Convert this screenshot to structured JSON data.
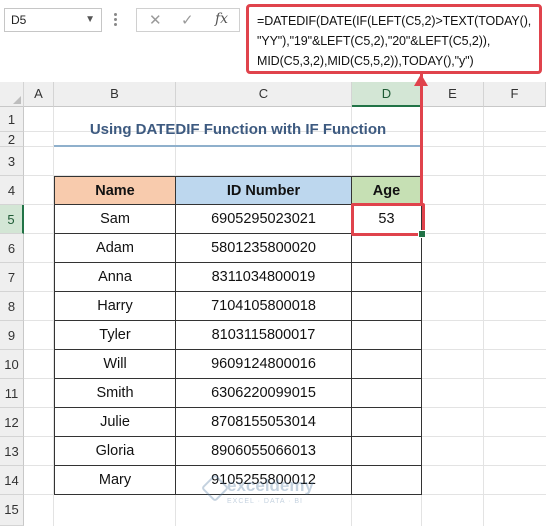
{
  "formula_bar": {
    "name_box": "D5",
    "cancel_icon": "close-icon",
    "enter_icon": "check-icon",
    "fx_label": "fx",
    "formula_line1": "=DATEDIF(DATE(IF(LEFT(C5,2)>TEXT(TODAY(),",
    "formula_line2": "\"YY\"),\"19\"&LEFT(C5,2),\"20\"&LEFT(C5,2)),",
    "formula_line3": "MID(C5,3,2),MID(C5,5,2)),TODAY(),\"y\")"
  },
  "columns": [
    "A",
    "B",
    "C",
    "D",
    "E",
    "F"
  ],
  "selected_column": "D",
  "rows": [
    "1",
    "2",
    "3",
    "4",
    "5",
    "6",
    "7",
    "8",
    "9",
    "10",
    "11",
    "12",
    "13",
    "14",
    "15"
  ],
  "selected_row": "5",
  "sheet": {
    "title": "Using DATEDIF Function with IF Function",
    "headers": {
      "name": "Name",
      "id": "ID Number",
      "age": "Age"
    },
    "records": [
      {
        "name": "Sam",
        "id": "6905295023021",
        "age": "53"
      },
      {
        "name": "Adam",
        "id": "5801235800020",
        "age": ""
      },
      {
        "name": "Anna",
        "id": "8311034800019",
        "age": ""
      },
      {
        "name": "Harry",
        "id": "7104105800018",
        "age": ""
      },
      {
        "name": "Tyler",
        "id": "8103115800017",
        "age": ""
      },
      {
        "name": "Will",
        "id": "9609124800016",
        "age": ""
      },
      {
        "name": "Smith",
        "id": "6306220099015",
        "age": ""
      },
      {
        "name": "Julie",
        "id": "8708155053014",
        "age": ""
      },
      {
        "name": "Gloria",
        "id": "8906055066013",
        "age": ""
      },
      {
        "name": "Mary",
        "id": "9105255800012",
        "age": ""
      }
    ]
  },
  "watermark": {
    "name": "exceldemy",
    "tagline": "EXCEL · DATA · BI"
  },
  "colors": {
    "highlight": "#e0434c",
    "name_header": "#f8cbad",
    "id_header": "#bdd7ee",
    "age_header": "#c6e0b4",
    "title": "#3d5a80"
  }
}
